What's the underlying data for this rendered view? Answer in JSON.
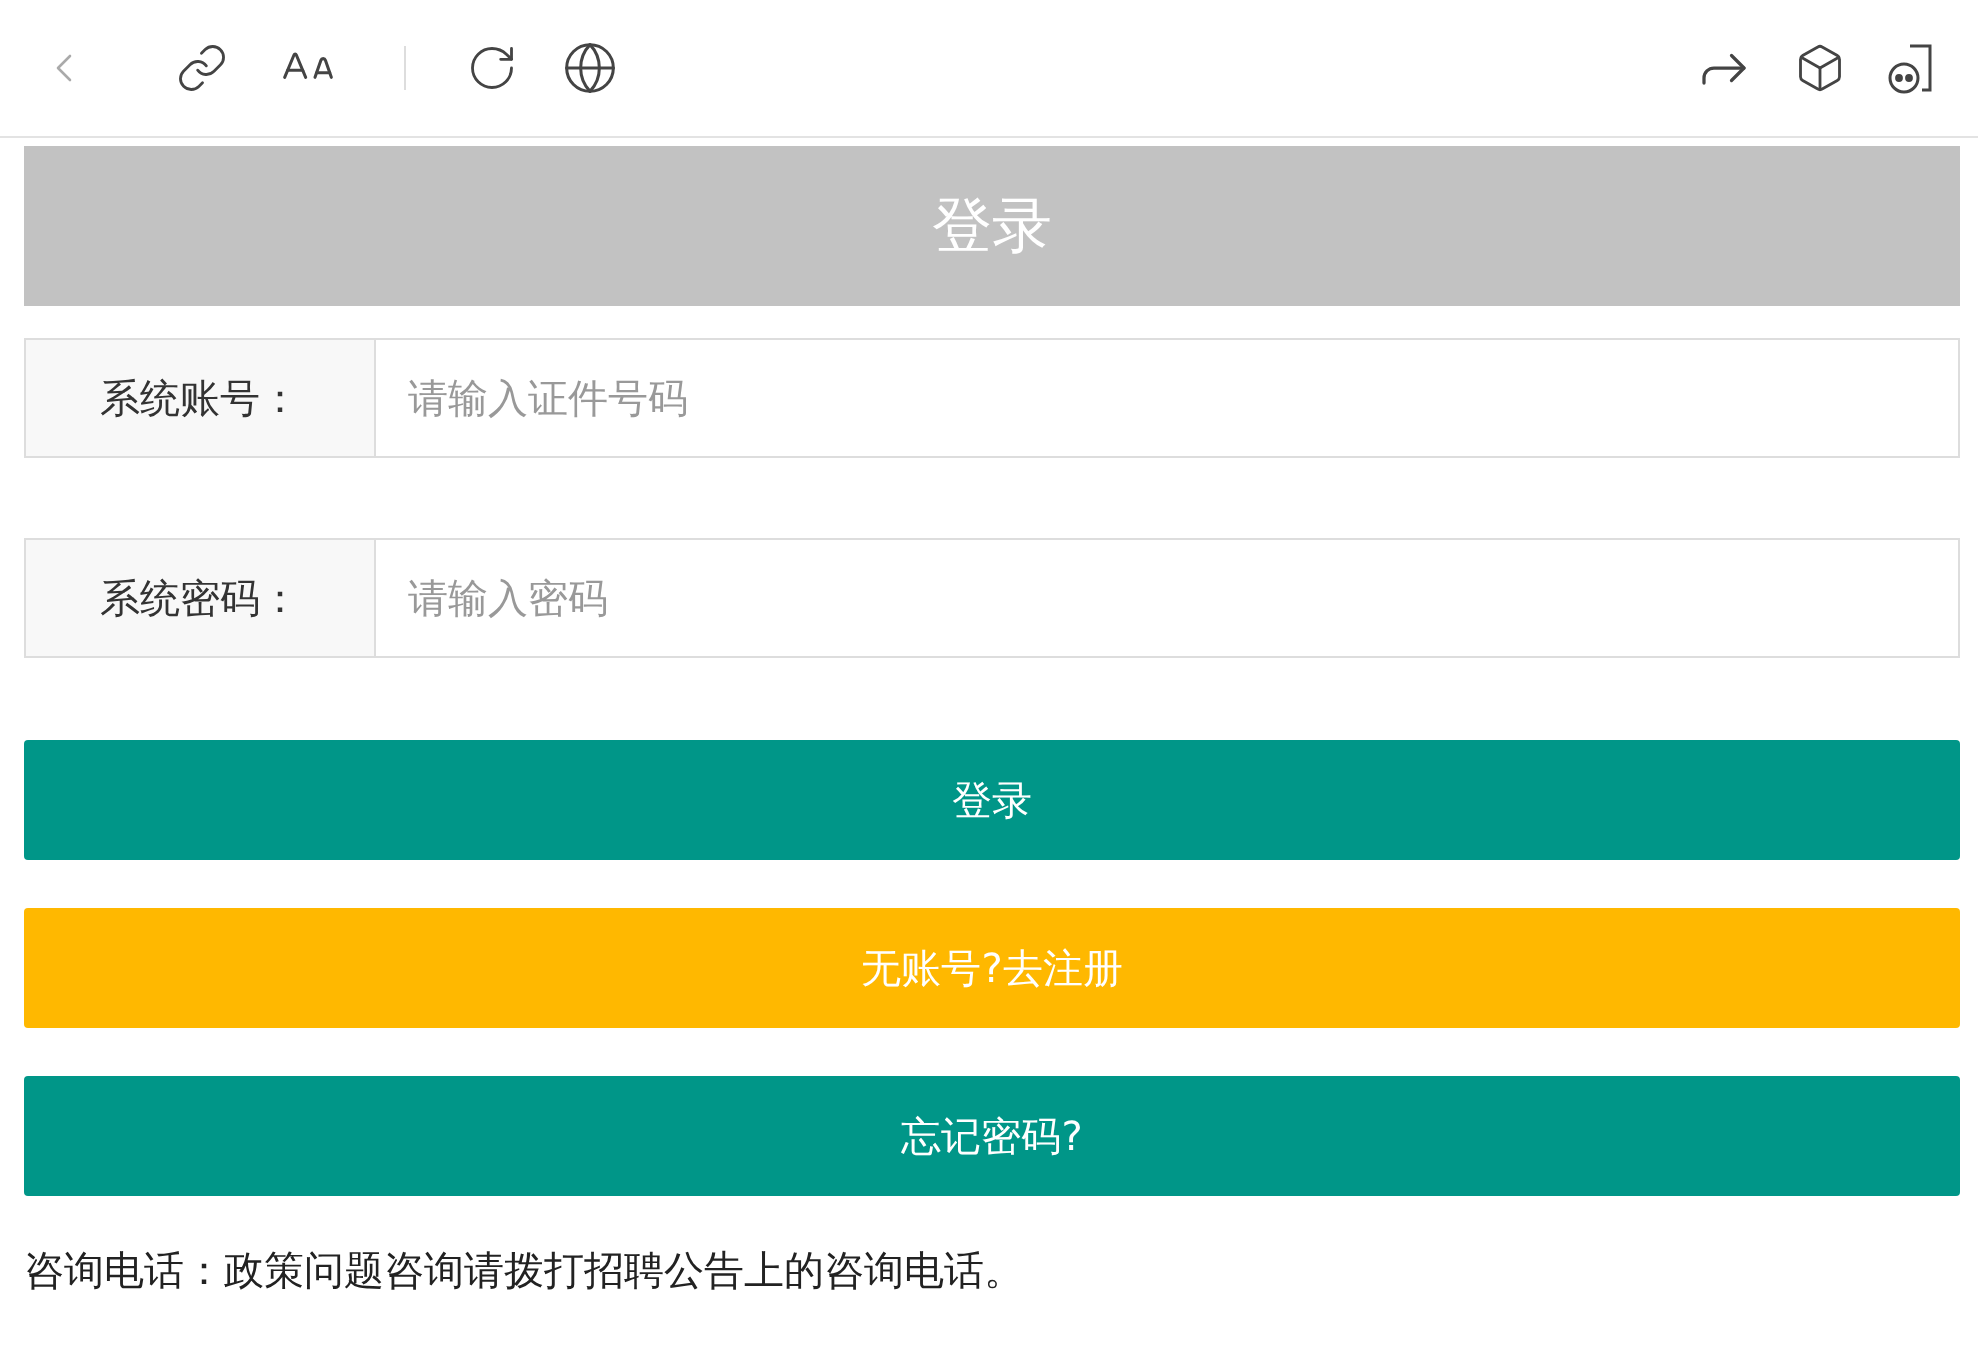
{
  "header": {
    "title": "登录"
  },
  "fields": [
    {
      "label": "系统账号：",
      "placeholder": "请输入证件号码"
    },
    {
      "label": "系统密码：",
      "placeholder": "请输入密码"
    }
  ],
  "buttons": [
    {
      "label": "登录",
      "kind": "primary"
    },
    {
      "label": "无账号?去注册",
      "kind": "warning"
    },
    {
      "label": "忘记密码?",
      "kind": "primary"
    }
  ],
  "note": "咨询电话：政策问题咨询请拨打招聘公告上的咨询电话。"
}
